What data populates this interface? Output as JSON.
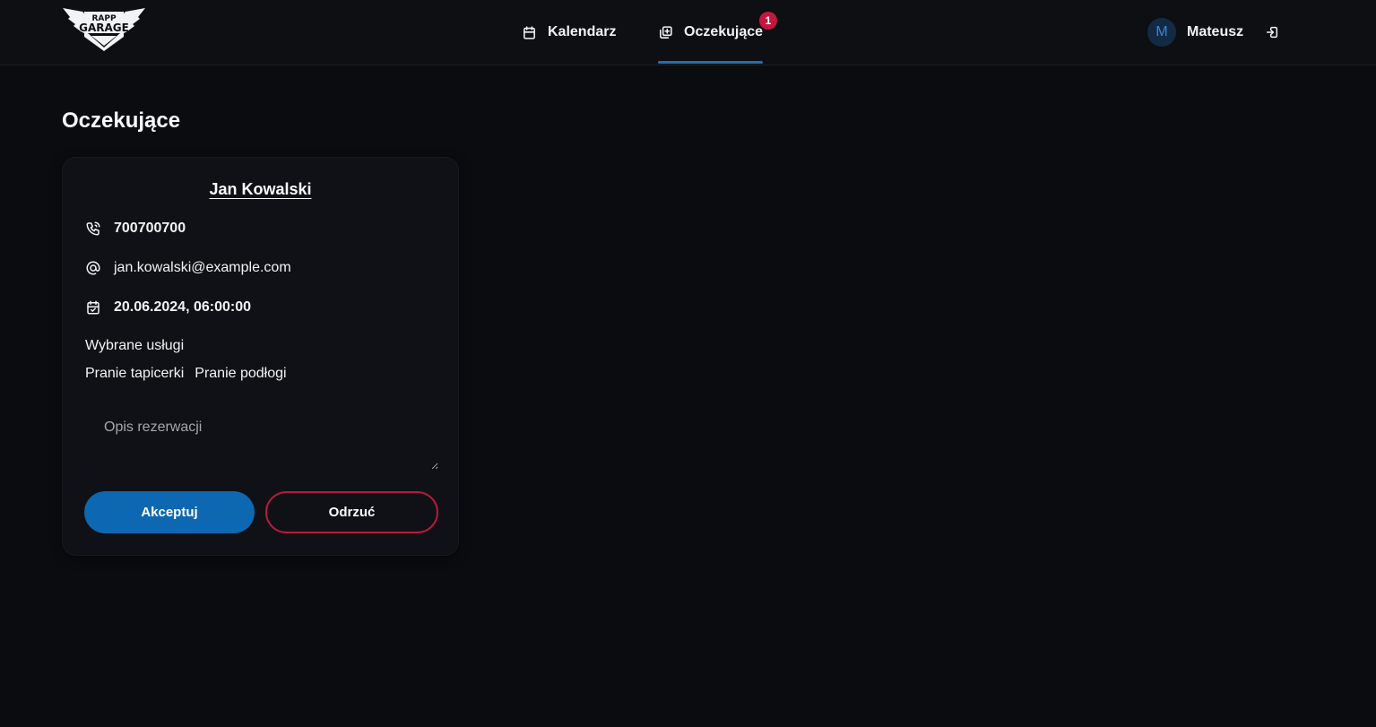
{
  "brand": {
    "logo_top": "RAPP",
    "logo_main": "GARAGE"
  },
  "nav": {
    "items": [
      {
        "label": "Kalendarz",
        "icon": "calendar-icon"
      },
      {
        "label": "Oczekujące",
        "icon": "add-square-icon",
        "badge": "1",
        "active": true
      }
    ]
  },
  "user": {
    "initial": "M",
    "name": "Mateusz",
    "logout_icon": "logout-icon"
  },
  "page": {
    "title": "Oczekujące"
  },
  "reservation": {
    "client_name": "Jan Kowalski",
    "phone": "700700700",
    "email": "jan.kowalski@example.com",
    "date": "20.06.2024, 06:00:00",
    "services_label": "Wybrane usługi",
    "services": [
      "Pranie tapicerki",
      "Pranie podłogi"
    ],
    "description_placeholder": "Opis rezerwacji",
    "description_value": "",
    "accept_label": "Akceptuj",
    "reject_label": "Odrzuć"
  },
  "colors": {
    "background": "#0b0c10",
    "header": "#0e0f13",
    "card": "#101116",
    "accent": "#0e67b1",
    "danger": "#b51b3b",
    "badge": "#c4173f",
    "text": "#f1f3f5"
  }
}
